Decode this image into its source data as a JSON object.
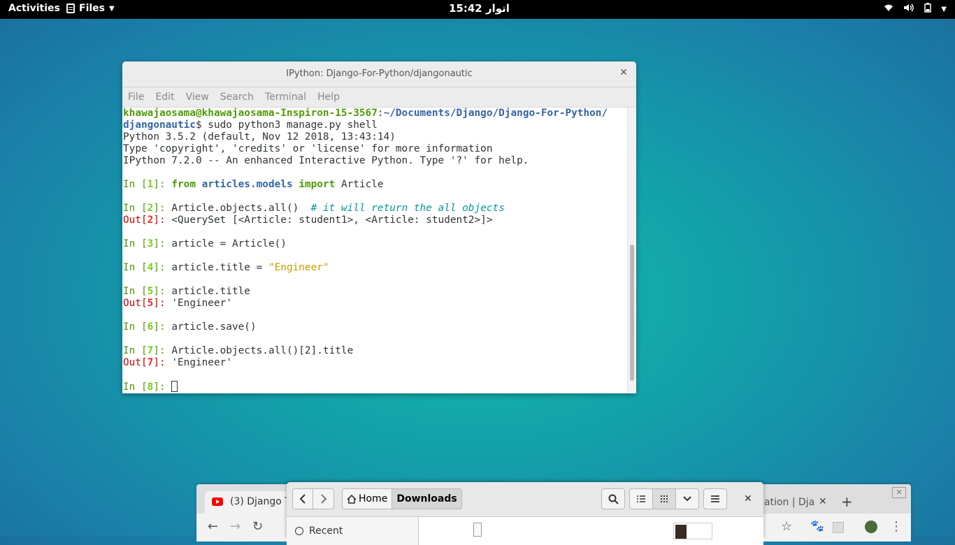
{
  "topbar": {
    "activities": "Activities",
    "app_menu": "Files",
    "clock": "15:42 اتوار",
    "tray_icons": [
      "wifi-icon",
      "volume-icon",
      "battery-icon",
      "power-menu-icon"
    ]
  },
  "terminal": {
    "title": "IPython: Django-For-Python/djangonautic",
    "menu": [
      "File",
      "Edit",
      "View",
      "Search",
      "Terminal",
      "Help"
    ],
    "prompt_user": "khawajaosama@khawajaosama-Inspiron-15-3567",
    "prompt_path_1": "~/Documents/Django/Django-For-Python/",
    "prompt_path_2": "djangonautic",
    "command": "$ sudo python3 manage.py shell",
    "banner_1": "Python 3.5.2 (default, Nov 12 2018, 13:43:14)",
    "banner_2": "Type 'copyright', 'credits' or 'license' for more information",
    "banner_3": "IPython 7.2.0 -- An enhanced Interactive Python. Type '?' for help.",
    "in1": {
      "num": "1",
      "kw_from": "from",
      "module": "articles.models",
      "kw_import": "import",
      "name": "Article"
    },
    "in2": {
      "num": "2",
      "code": "Article.objects.all()  ",
      "comment": "# it will return the all objects"
    },
    "out2": {
      "num": "2",
      "value": "<QuerySet [<Article: student1>, <Article: student2>]>"
    },
    "in3": {
      "num": "3",
      "code": "article = Article()"
    },
    "in4": {
      "num": "4",
      "code": "article.title = ",
      "string": "\"Engineer\""
    },
    "in5": {
      "num": "5",
      "code": "article.title"
    },
    "out5": {
      "num": "5",
      "value": "'Engineer'"
    },
    "in6": {
      "num": "6",
      "code": "article.save()"
    },
    "in7": {
      "num": "7",
      "code": "Article.objects.all()[2].title"
    },
    "out7": {
      "num": "7",
      "value": "'Engineer'"
    },
    "in8": {
      "num": "8"
    }
  },
  "browser": {
    "tab1_label": "(3) Django T",
    "tab2_label": "ation | Dja",
    "tab_close": "✕",
    "new_tab": "+",
    "nav": {
      "back": "←",
      "forward": "→",
      "reload": "↻",
      "star": "☆",
      "menu": "⋮"
    }
  },
  "files": {
    "path_home": "Home",
    "path_current": "Downloads",
    "sidebar_recent": "Recent",
    "close": "✕"
  }
}
